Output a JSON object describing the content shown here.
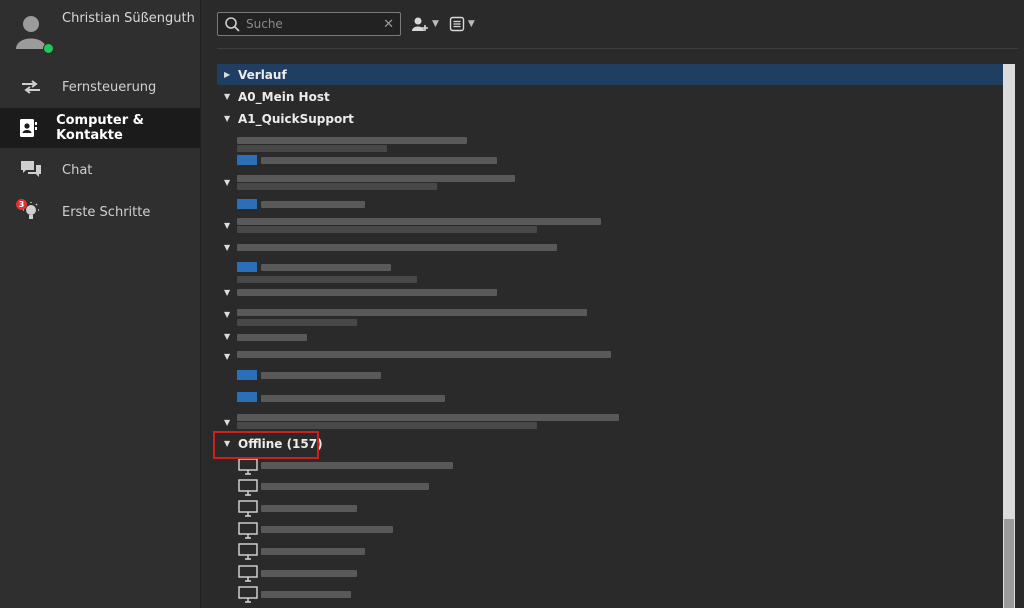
{
  "user": {
    "name": "Christian Süßenguth"
  },
  "nav": [
    {
      "label": "Fernsteuerung",
      "icon": "arrows-icon"
    },
    {
      "label": "Computer & Kontakte",
      "icon": "contact-card-icon",
      "active": true
    },
    {
      "label": "Chat",
      "icon": "chat-icon"
    },
    {
      "label": "Erste Schritte",
      "icon": "lightbulb-icon",
      "badge": "3"
    }
  ],
  "search": {
    "placeholder": "Suche"
  },
  "groups": {
    "verlauf": "Verlauf",
    "mein_host": "A0_Mein Host",
    "quicksupport": "A1_QuickSupport",
    "offline": "Offline (157)"
  }
}
